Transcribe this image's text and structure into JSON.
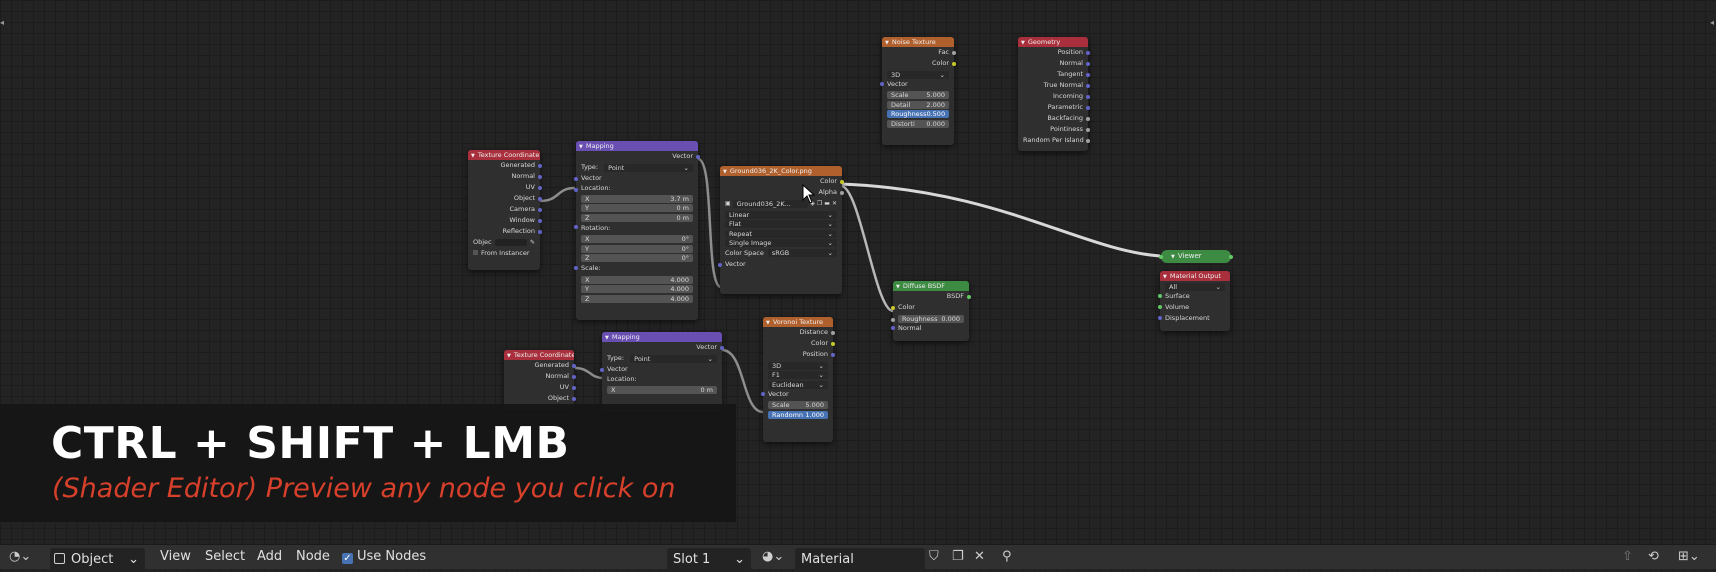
{
  "overlay": {
    "title": "CTRL + SHIFT + LMB",
    "subtitle": "(Shader Editor) Preview any node you click on"
  },
  "toolbar": {
    "mode_value": "Object",
    "menu_view": "View",
    "menu_select": "Select",
    "menu_add": "Add",
    "menu_node": "Node",
    "use_nodes_label": "Use Nodes",
    "use_nodes_checked": true,
    "slot_value": "Slot 1",
    "material_value": "Material",
    "icons": [
      "editor-type-icon",
      "object-mode-icon",
      "material-sphere-icon",
      "shield-icon",
      "duplicate-icon",
      "close-icon",
      "pin-icon",
      "arrow-up-icon",
      "snap-icon",
      "overlay-icon"
    ]
  },
  "nodes": {
    "tex_coord_1": {
      "title": "Texture Coordinate",
      "outputs": [
        "Generated",
        "Normal",
        "UV",
        "Object",
        "Camera",
        "Window",
        "Reflection"
      ],
      "object_label": "Objec",
      "from_instancer": "From Instancer"
    },
    "mapping_1": {
      "title": "Mapping",
      "output": "Vector",
      "type_label": "Type:",
      "type_value": "Point",
      "vector_input": "Vector",
      "location_label": "Location:",
      "location": [
        {
          "axis": "X",
          "value": "3.7 m"
        },
        {
          "axis": "Y",
          "value": "0 m"
        },
        {
          "axis": "Z",
          "value": "0 m"
        }
      ],
      "rotation_label": "Rotation:",
      "rotation": [
        {
          "axis": "X",
          "value": "0°"
        },
        {
          "axis": "Y",
          "value": "0°"
        },
        {
          "axis": "Z",
          "value": "0°"
        }
      ],
      "scale_label": "Scale:",
      "scale": [
        {
          "axis": "X",
          "value": "4.000"
        },
        {
          "axis": "Y",
          "value": "4.000"
        },
        {
          "axis": "Z",
          "value": "4.000"
        }
      ]
    },
    "image_texture": {
      "title": "Ground036_2K_Color.png",
      "outputs": [
        "Color",
        "Alpha"
      ],
      "image_name": "Ground036_2K...",
      "interpolation": "Linear",
      "projection": "Flat",
      "extension": "Repeat",
      "source": "Single Image",
      "color_space_label": "Color Space",
      "color_space_value": "sRGB",
      "vector_input": "Vector"
    },
    "noise_texture": {
      "title": "Noise Texture",
      "outputs": [
        "Fac",
        "Color"
      ],
      "dimensions": "3D",
      "vector_input": "Vector",
      "fields": [
        {
          "label": "Scale",
          "value": "5.000"
        },
        {
          "label": "Detail",
          "value": "2.000"
        },
        {
          "label": "Roughness",
          "value": "0.500"
        },
        {
          "label": "Distorti",
          "value": "0.000"
        }
      ]
    },
    "geometry": {
      "title": "Geometry",
      "outputs": [
        "Position",
        "Normal",
        "Tangent",
        "True Normal",
        "Incoming",
        "Parametric",
        "Backfacing",
        "Pointiness",
        "Random Per Island"
      ]
    },
    "viewer": {
      "title": "Viewer"
    },
    "material_output": {
      "title": "Material Output",
      "target": "All",
      "inputs": [
        "Surface",
        "Volume",
        "Displacement"
      ]
    },
    "diffuse_bsdf": {
      "title": "Diffuse BSDF",
      "output": "BSDF",
      "color_input": "Color",
      "roughness_label": "Roughness",
      "roughness_value": "0.000",
      "normal_input": "Normal"
    },
    "voronoi": {
      "title": "Voronoi Texture",
      "outputs": [
        "Distance",
        "Color",
        "Position"
      ],
      "dimensions": "3D",
      "feature": "F1",
      "metric": "Euclidean",
      "vector_input": "Vector",
      "scale_label": "Scale",
      "scale_value": "5.000",
      "randomness_label": "Randomn",
      "randomness_value": "1.000"
    },
    "tex_coord_2": {
      "title": "Texture Coordinate",
      "outputs": [
        "Generated",
        "Normal",
        "UV",
        "Object"
      ]
    },
    "mapping_2": {
      "title": "Mapping",
      "output": "Vector",
      "type_label": "Type:",
      "type_value": "Point",
      "vector_input": "Vector",
      "location_label": "Location:",
      "loc_x_label": "X",
      "loc_x_value": "0 m"
    }
  },
  "colors": {
    "header_input": "#a82f3b",
    "header_vector": "#6a4fb3",
    "header_texture": "#b0602d",
    "header_shader": "#3d8a43",
    "socket_vector": "#6363c7",
    "socket_color": "#c7c729",
    "socket_float": "#a1a1a1",
    "socket_shader": "#63c763",
    "subtitle": "#d7402a"
  }
}
